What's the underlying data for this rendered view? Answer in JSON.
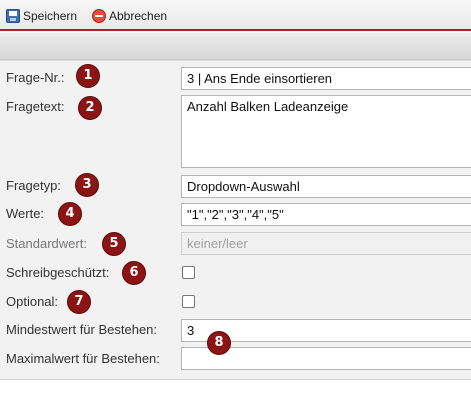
{
  "toolbar": {
    "save_label": "Speichern",
    "cancel_label": "Abbrechen"
  },
  "form": {
    "question_no": {
      "label": "Frage-Nr.:",
      "value": "3 | Ans Ende einsortieren"
    },
    "question_text": {
      "label": "Fragetext:",
      "value": "Anzahl Balken Ladeanzeige"
    },
    "question_type": {
      "label": "Fragetyp:",
      "value": "Dropdown-Auswahl"
    },
    "values": {
      "label": "Werte:",
      "value": "\"1\",\"2\",\"3\",\"4\",\"5\""
    },
    "default_value": {
      "label": "Standardwert:",
      "placeholder": "keiner/leer"
    },
    "read_only": {
      "label": "Schreibgeschützt:",
      "checked": false
    },
    "optional": {
      "label": "Optional:",
      "checked": false
    },
    "min_pass": {
      "label": "Mindestwert für Bestehen:",
      "value": "3"
    },
    "max_pass": {
      "label": "Maximalwert für Bestehen:",
      "value": ""
    }
  },
  "badges": [
    "1",
    "2",
    "3",
    "4",
    "5",
    "6",
    "7",
    "8"
  ],
  "colors": {
    "accent": "#c8102e",
    "badge": "#8c1414"
  },
  "icons": {
    "save": "floppy-disk-icon",
    "cancel": "cancel-circle-icon"
  }
}
